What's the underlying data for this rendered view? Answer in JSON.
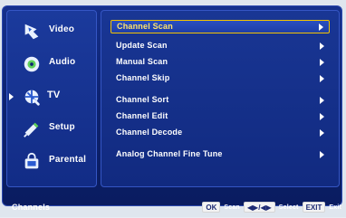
{
  "app": {
    "title": "Channels"
  },
  "colors": {
    "frame": "#0d2372",
    "panel": "#122c86",
    "highlight_border": "#f5c400",
    "highlight_text": "#ffe36b",
    "text": "#ffffff",
    "key_bg": "#f3f3f3",
    "key_text": "#1d2a73"
  },
  "sidebar": {
    "items": [
      {
        "label": "Video",
        "icon": "video-icon"
      },
      {
        "label": "Audio",
        "icon": "audio-icon"
      },
      {
        "label": "TV",
        "icon": "tv-icon",
        "selected": true
      },
      {
        "label": "Setup",
        "icon": "setup-icon"
      },
      {
        "label": "Parental",
        "icon": "parental-icon"
      }
    ]
  },
  "menu": {
    "items": [
      {
        "label": "Channel Scan",
        "highlight": true,
        "arrow": true
      },
      {
        "label": "Update Scan",
        "arrow": true
      },
      {
        "label": "Manual Scan",
        "arrow": true
      },
      {
        "label": "Channel Skip",
        "arrow": true
      },
      {
        "label": "Channel Sort",
        "arrow": true
      },
      {
        "label": "Channel Edit",
        "arrow": true
      },
      {
        "label": "Channel Decode",
        "arrow": true
      },
      {
        "label": "Analog Channel Fine Tune",
        "arrow": true
      }
    ]
  },
  "footer": {
    "left": "Channels",
    "keys": [
      {
        "key": "OK",
        "hint": "Scan"
      },
      {
        "key": "◀▶/◀▶",
        "hint": "Select"
      },
      {
        "key": "EXIT",
        "hint": "Exit"
      }
    ]
  }
}
